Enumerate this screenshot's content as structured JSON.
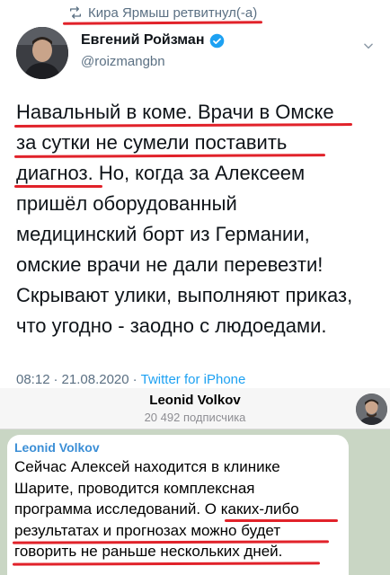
{
  "tweet": {
    "retweet_text": "Кира Ярмыш ретвитнул(-а)",
    "display_name": "Евгений Ройзман",
    "handle": "@roizmangbn",
    "text_lines": [
      "Навальный в коме. Врачи в Омске",
      "за сутки не сумели поставить",
      "диагноз. Но, когда за Алексеем",
      "пришёл оборудованный",
      "медицинский борт из Германии,",
      "омские врачи не дали перевезти!",
      "Скрывают улики, выполняют приказ,",
      "что угодно - заодно с людоедами."
    ],
    "time": "08:12",
    "separator": "·",
    "date": "21.08.2020",
    "source": "Twitter for iPhone",
    "colors": {
      "link": "#1da1f2",
      "underline": "#e1222a",
      "verified": "#1da1f2"
    }
  },
  "telegram": {
    "channel_name": "Leonid Volkov",
    "subscribers": "20 492 подписчика",
    "message": {
      "author": "Leonid Volkov",
      "lines": [
        "Сейчас Алексей находится в клинике",
        "Шарите, проводится комплексная",
        "программа исследований. О каких-либо",
        "результатах и прогнозах можно будет",
        "говорить не раньше нескольких дней."
      ]
    },
    "colors": {
      "background": "#c9d6c4",
      "author": "#3c8fd6"
    }
  },
  "icons": {
    "retweet": "retweet-icon",
    "verified": "verified-badge-icon",
    "menu": "chevron-down-icon"
  }
}
